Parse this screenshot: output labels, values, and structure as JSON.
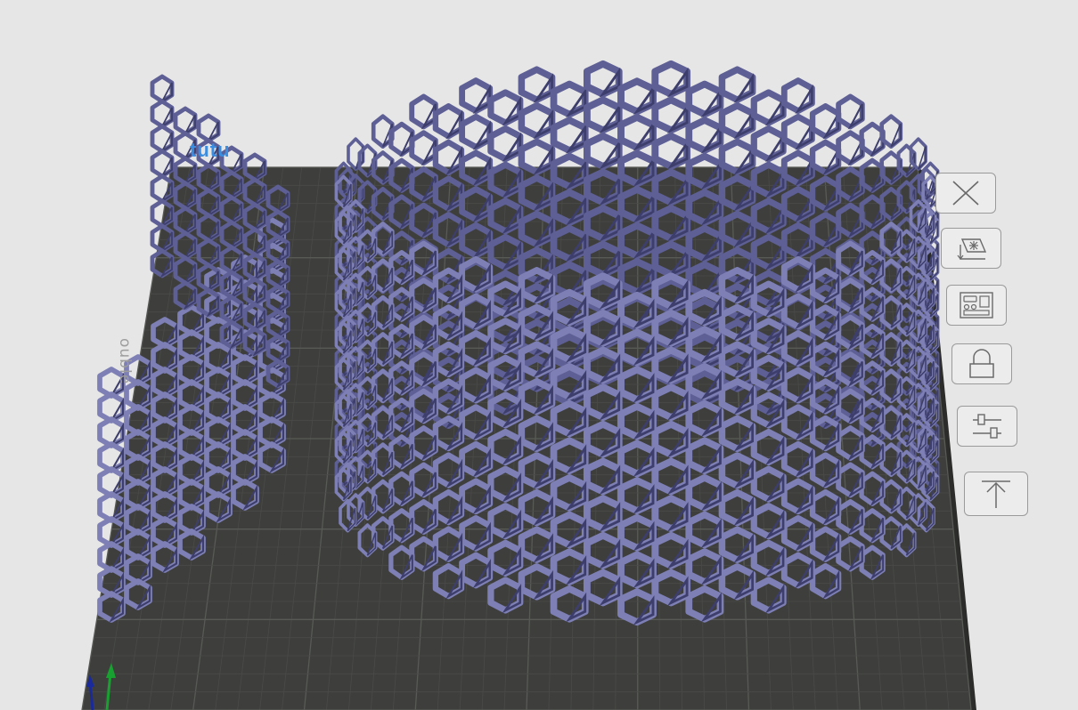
{
  "viewport": {
    "plate_logo_text": "tutu",
    "plate_side_text": "ouble",
    "model_color": "#5e5f95",
    "model_dark_color": "#3d3e6b",
    "model_light_color": "#7d7fb5",
    "plate_color": "#3e3f3c",
    "plate_grid_color": "#585a56"
  },
  "toolbar": {
    "buttons": [
      {
        "name": "close-button",
        "icon": "close-icon"
      },
      {
        "name": "auto-arrange-button",
        "icon": "arrange-icon"
      },
      {
        "name": "layout-button",
        "icon": "layout-icon"
      },
      {
        "name": "lock-button",
        "icon": "lock-icon"
      },
      {
        "name": "settings-button",
        "icon": "sliders-icon"
      },
      {
        "name": "lay-flat-button",
        "icon": "arrow-up-icon"
      }
    ]
  },
  "axes": {
    "x_color": "#1a2a9a",
    "y_color": "#18a030"
  }
}
